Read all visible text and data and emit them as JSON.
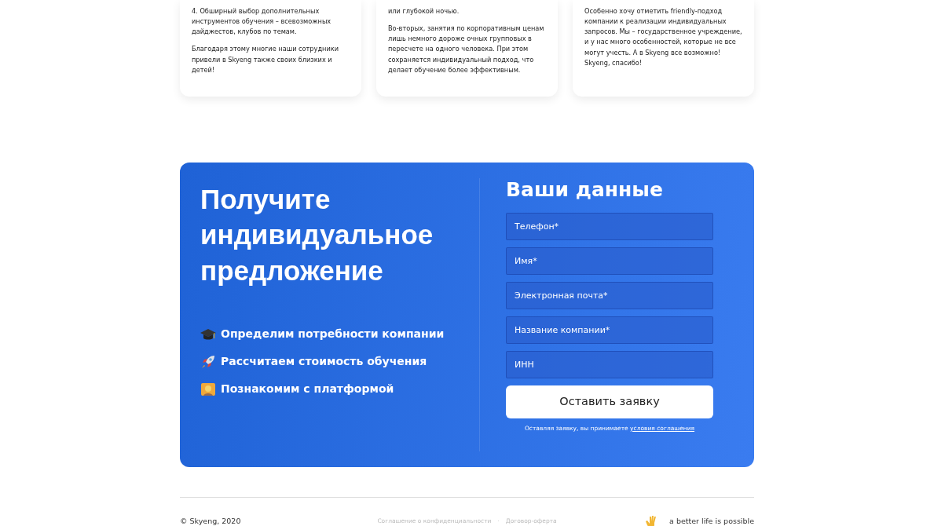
{
  "reviews": [
    {
      "paragraphs": [
        "4. Обширный выбор дополнительных инструментов обучения – всевозможных дайджестов, клубов по темам.",
        "Благодаря этому многие наши сотрудники привели в Skyeng также своих близких и детей!"
      ]
    },
    {
      "paragraphs": [
        "или глубокой ночью.",
        "Во-вторых, занятия по корпоративным ценам лишь немного дороже очных групповых в пересчете на одного человека. При этом сохраняется индивидуальный подход, что делает обучение более эффективным."
      ]
    },
    {
      "paragraphs": [
        "Особенно хочу отметить friendly-подход компании к реализации индивидуальных запросов. Мы – государственное учреждение, и у нас много особенностей, которые не все могут учесть. А в Skyeng все возможно! Skyeng, спасибо!"
      ]
    }
  ],
  "offer": {
    "title": "Получите индивидуальное предложение",
    "benefits": [
      {
        "kind": "cap",
        "text": "Определим потребности компании"
      },
      {
        "kind": "rocket",
        "text": "Рассчитаем стоимость обучения"
      },
      {
        "kind": "person",
        "text": "Познакомим с платформой"
      }
    ]
  },
  "form": {
    "title": "Ваши данные",
    "fields": [
      {
        "placeholder": "Телефон*"
      },
      {
        "placeholder": "Имя*"
      },
      {
        "placeholder": "Электронная почта*"
      },
      {
        "placeholder": "Название компании*"
      },
      {
        "placeholder": "ИНН"
      }
    ],
    "submit": "Оставить заявку",
    "consent": "Оставляя заявку, вы принимаете",
    "consent_link": "условия соглашения"
  },
  "footer": {
    "copyright": "© Skyeng, 2020",
    "links": [
      "Соглашение о конфиденциальности",
      "Договор-оферта"
    ],
    "separator": "·",
    "slogan": "a better life is possible"
  }
}
